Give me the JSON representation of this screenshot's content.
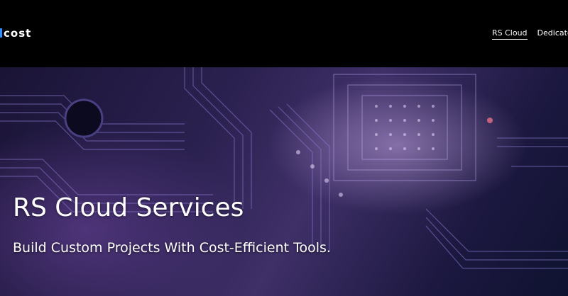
{
  "header": {
    "logo_text": "cost",
    "nav": [
      {
        "label": "RS Cloud",
        "active": true
      },
      {
        "label": "Dedicated",
        "active": false
      }
    ]
  },
  "hero": {
    "title": "RS Cloud Services",
    "subtitle": "Build Custom Projects With Cost-Efficient Tools."
  }
}
